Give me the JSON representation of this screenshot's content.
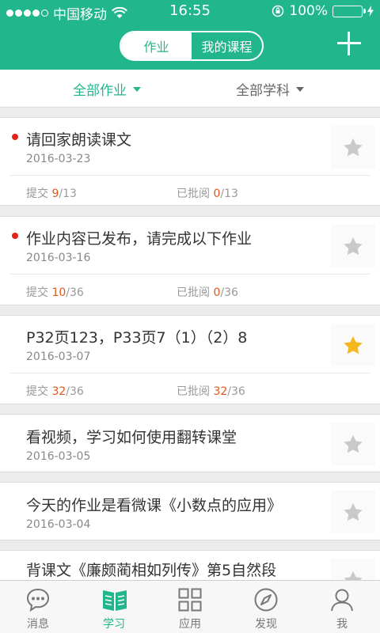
{
  "status_bar": {
    "carrier": "中国移动",
    "time": "16:55",
    "battery": "100%",
    "battery_level": 1.0
  },
  "header": {
    "segments": [
      {
        "label": "作业",
        "active": true
      },
      {
        "label": "我的课程",
        "active": false
      }
    ],
    "add_icon": "plus-icon",
    "accent_color": "#21b68c"
  },
  "filters": [
    {
      "label": "全部作业",
      "active": true
    },
    {
      "label": "全部学科",
      "active": false
    }
  ],
  "assignments": [
    {
      "title": "请回家朗读课文",
      "date": "2016-03-23",
      "unread": true,
      "starred": false,
      "submit_label": "提交",
      "submitted": "9",
      "total": "13",
      "review_label": "已批阅",
      "reviewed": "0",
      "review_total": "13"
    },
    {
      "title": "作业内容已发布，请完成以下作业",
      "date": "2016-03-16",
      "unread": true,
      "starred": false,
      "submit_label": "提交",
      "submitted": "10",
      "total": "36",
      "review_label": "已批阅",
      "reviewed": "0",
      "review_total": "36"
    },
    {
      "title": "P32页123，P33页7（1）（2）8",
      "date": "2016-03-07",
      "unread": false,
      "starred": true,
      "submit_label": "提交",
      "submitted": "32",
      "total": "36",
      "review_label": "已批阅",
      "reviewed": "32",
      "review_total": "36"
    },
    {
      "title": "看视频，学习如何使用翻转课堂",
      "date": "2016-03-05",
      "unread": false,
      "starred": false
    },
    {
      "title": "今天的作业是看微课《小数点的应用》",
      "date": "2016-03-04",
      "unread": false,
      "starred": false
    },
    {
      "title": "背课文《廉颇蔺相如列传》第5自然段",
      "date": "",
      "unread": false,
      "starred": false
    }
  ],
  "tabbar": [
    {
      "label": "消息",
      "icon": "message-bubble-icon",
      "active": false
    },
    {
      "label": "学习",
      "icon": "book-icon",
      "active": true
    },
    {
      "label": "应用",
      "icon": "grid-icon",
      "active": false
    },
    {
      "label": "发现",
      "icon": "compass-icon",
      "active": false
    },
    {
      "label": "我",
      "icon": "person-icon",
      "active": false
    }
  ]
}
